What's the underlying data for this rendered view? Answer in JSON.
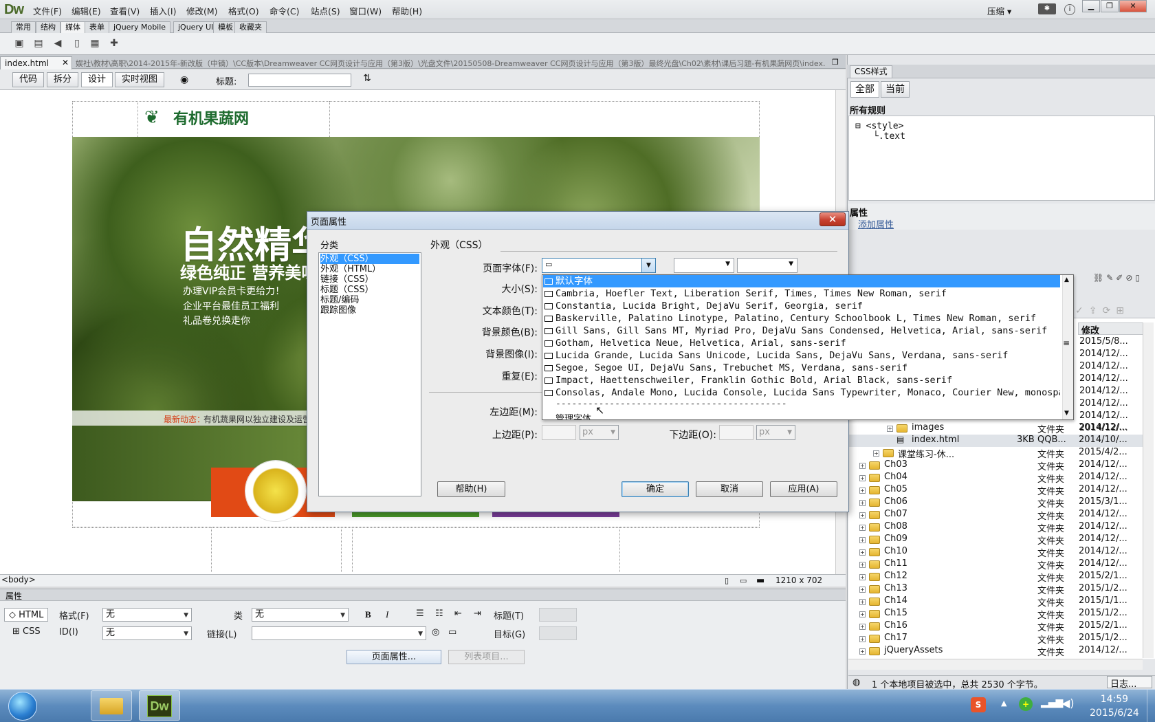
{
  "app": {
    "logo": "Dw",
    "layout_switch": "压缩 ▾"
  },
  "menu": [
    "文件(F)",
    "编辑(E)",
    "查看(V)",
    "插入(I)",
    "修改(M)",
    "格式(O)",
    "命令(C)",
    "站点(S)",
    "窗口(W)",
    "帮助(H)"
  ],
  "insert_tabs": [
    "常用",
    "结构",
    "媒体",
    "表单",
    "jQuery Mobile",
    "jQuery UI",
    "模板",
    "收藏夹"
  ],
  "document": {
    "tab": "index.html",
    "path": "娱社\\教材\\高职\\2014-2015年-新改版（中镝）\\CC版本\\Dreamweaver CC网页设计与应用（第3版）\\光盘文件\\20150508-Dreamweaver CC网页设计与应用（第3版）最终光盘\\Ch02\\素材\\课后习题-有机果蔬网页\\index.html",
    "views": [
      "代码",
      "拆分",
      "设计",
      "实时视图"
    ],
    "title_label": "标题:",
    "title_value": ""
  },
  "page": {
    "brand": "有机果蔬网",
    "slogan1": "自然精华",
    "slogan2": "绿色纯正 营养美味",
    "perks": [
      "办理VIP会员卡更给力！",
      "企业平台最佳员工福利",
      "礼品卷兑换走你"
    ],
    "news_label": "最新动态：",
    "news_text": "有机蔬果网以独立建设及运营"
  },
  "status": {
    "tag": "<body>",
    "size": "1210 x 702"
  },
  "properties": {
    "title": "属性",
    "html_btn": "HTML",
    "css_btn": "CSS",
    "format_label": "格式(F)",
    "format_value": "无",
    "class_label": "类",
    "class_value": "无",
    "id_label": "ID(I)",
    "id_value": "无",
    "link_label": "链接(L)",
    "heading_label": "标题(T)",
    "target_label": "目标(G)",
    "page_props_btn": "页面属性...",
    "list_item_btn": "列表项目..."
  },
  "css_panel": {
    "tab": "CSS样式",
    "all": "全部",
    "current": "当前",
    "rules_header": "所有规则",
    "rules": [
      "<style>",
      ".text"
    ],
    "attr_header": "属性",
    "add_attr": "添加属性"
  },
  "files": {
    "mod_header": "修改",
    "top_dates": [
      "2015/5/8...",
      "2014/12/...",
      "2014/12/...",
      "2014/12/...",
      "2014/12/...",
      "2014/12/...",
      "2014/12/...",
      "2014/12/..."
    ],
    "rows": [
      {
        "name": "images",
        "size": "",
        "type": "文件夹",
        "mod": "2014/12/..."
      },
      {
        "name": "index.html",
        "size": "3KB",
        "type": "QQB...",
        "mod": "2014/10/..."
      },
      {
        "name": "课堂练习-休...",
        "size": "",
        "type": "文件夹",
        "mod": "2015/4/2..."
      },
      {
        "name": "Ch03",
        "size": "",
        "type": "文件夹",
        "mod": "2014/12/..."
      },
      {
        "name": "Ch04",
        "size": "",
        "type": "文件夹",
        "mod": "2014/12/..."
      },
      {
        "name": "Ch05",
        "size": "",
        "type": "文件夹",
        "mod": "2014/12/..."
      },
      {
        "name": "Ch06",
        "size": "",
        "type": "文件夹",
        "mod": "2015/3/1..."
      },
      {
        "name": "Ch07",
        "size": "",
        "type": "文件夹",
        "mod": "2014/12/..."
      },
      {
        "name": "Ch08",
        "size": "",
        "type": "文件夹",
        "mod": "2014/12/..."
      },
      {
        "name": "Ch09",
        "size": "",
        "type": "文件夹",
        "mod": "2014/12/..."
      },
      {
        "name": "Ch10",
        "size": "",
        "type": "文件夹",
        "mod": "2014/12/..."
      },
      {
        "name": "Ch11",
        "size": "",
        "type": "文件夹",
        "mod": "2014/12/..."
      },
      {
        "name": "Ch12",
        "size": "",
        "type": "文件夹",
        "mod": "2015/2/1..."
      },
      {
        "name": "Ch13",
        "size": "",
        "type": "文件夹",
        "mod": "2015/1/2..."
      },
      {
        "name": "Ch14",
        "size": "",
        "type": "文件夹",
        "mod": "2015/1/1..."
      },
      {
        "name": "Ch15",
        "size": "",
        "type": "文件夹",
        "mod": "2015/1/2..."
      },
      {
        "name": "Ch16",
        "size": "",
        "type": "文件夹",
        "mod": "2015/2/1..."
      },
      {
        "name": "Ch17",
        "size": "",
        "type": "文件夹",
        "mod": "2015/1/2..."
      },
      {
        "name": "jQueryAssets",
        "size": "",
        "type": "文件夹",
        "mod": "2014/12/..."
      }
    ],
    "status": "1 个本地项目被选中，总共 2530 个字节。",
    "log_btn": "日志..."
  },
  "dialog": {
    "title": "页面属性",
    "category_label": "分类",
    "categories": [
      "外观（CSS）",
      "外观（HTML）",
      "链接（CSS）",
      "标题（CSS）",
      "标题/编码",
      "跟踪图像"
    ],
    "section": "外观（CSS）",
    "font_label": "页面字体(F):",
    "size_label": "大小(S):",
    "textcolor_label": "文本颜色(T):",
    "bgcolor_label": "背景颜色(B):",
    "bgimage_label": "背景图像(I):",
    "repeat_label": "重复(E):",
    "left_label": "左边距(M):",
    "top_label": "上边距(P):",
    "bottom_label": "下边距(O):",
    "unit": "px",
    "help": "帮助(H)",
    "ok": "确定",
    "cancel": "取消",
    "apply": "应用(A)",
    "font_options": [
      "默认字体",
      "Cambria, Hoefler Text, Liberation Serif, Times, Times New Roman, serif",
      "Constantia, Lucida Bright, DejaVu Serif, Georgia, serif",
      "Baskerville, Palatino Linotype, Palatino, Century Schoolbook L, Times New Roman, serif",
      "Gill Sans, Gill Sans MT, Myriad Pro, DejaVu Sans Condensed, Helvetica, Arial, sans-serif",
      "Gotham, Helvetica Neue, Helvetica, Arial, sans-serif",
      "Lucida Grande, Lucida Sans Unicode, Lucida Sans, DejaVu Sans, Verdana, sans-serif",
      "Segoe, Segoe UI, DejaVu Sans, Trebuchet MS, Verdana, sans-serif",
      "Impact, Haettenschweiler, Franklin Gothic Bold, Arial Black, sans-serif",
      "Consolas, Andale Mono, Lucida Console, Lucida Sans Typewriter, Monaco, Courier New, monospace"
    ],
    "separator": "-------------------------------------------",
    "manage_fonts": "管理字体..."
  },
  "taskbar": {
    "time": "14:59",
    "date": "2015/6/24",
    "dw_label": "Dw"
  }
}
